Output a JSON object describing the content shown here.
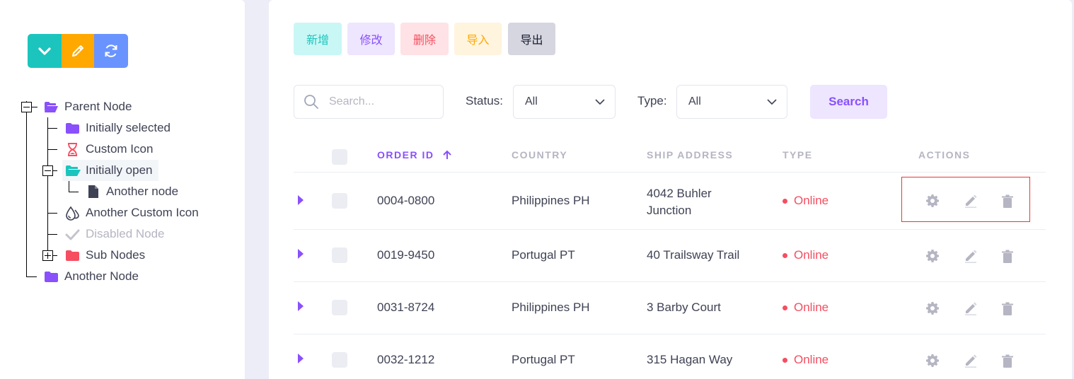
{
  "tree": {
    "toolbar": {
      "expand_icon": "chevron-down-icon",
      "edit_icon": "pencil-icon",
      "refresh_icon": "refresh-icon",
      "colors": {
        "teal": "#1bc5bd",
        "orange": "#ffa800",
        "blue": "#6993ff"
      }
    },
    "nodes": [
      {
        "label": "Parent Node",
        "icon": "folder-open-icon",
        "color": "#8950fc"
      },
      {
        "label": "Initially selected",
        "icon": "folder-icon",
        "color": "#8950fc"
      },
      {
        "label": "Custom Icon",
        "icon": "hourglass-icon",
        "color": "#f64e60"
      },
      {
        "label": "Initially open",
        "icon": "folder-open-icon",
        "color": "#1bc5bd"
      },
      {
        "label": "Another node",
        "icon": "file-icon",
        "color": "#3f4254"
      },
      {
        "label": "Another Custom Icon",
        "icon": "drop-icon",
        "color": "#3f4254"
      },
      {
        "label": "Disabled Node",
        "icon": "check-icon",
        "color": "#b5b5c3"
      },
      {
        "label": "Sub Nodes",
        "icon": "folder-icon",
        "color": "#f64e60"
      },
      {
        "label": "Another Node",
        "icon": "folder-icon",
        "color": "#8950fc"
      }
    ]
  },
  "actions": {
    "add": "新增",
    "edit": "修改",
    "delete": "删除",
    "import": "导入",
    "export": "导出"
  },
  "filters": {
    "search_placeholder": "Search...",
    "status_label": "Status:",
    "status_value": "All",
    "type_label": "Type:",
    "type_value": "All",
    "search_button": "Search"
  },
  "table": {
    "headers": {
      "order_id": "ORDER ID",
      "country": "COUNTRY",
      "ship_address": "SHIP ADDRESS",
      "type": "TYPE",
      "actions": "ACTIONS"
    },
    "sort": {
      "column": "order_id",
      "direction": "ascending"
    },
    "rows": [
      {
        "order_id": "0004-0800",
        "country": "Philippines PH",
        "address_line1": "4042 Buhler",
        "address_line2": "Junction",
        "type": "Online"
      },
      {
        "order_id": "0019-9450",
        "country": "Portugal PT",
        "address_line1": "40 Trailsway Trail",
        "address_line2": "",
        "type": "Online"
      },
      {
        "order_id": "0031-8724",
        "country": "Philippines PH",
        "address_line1": "3 Barby Court",
        "address_line2": "",
        "type": "Online"
      },
      {
        "order_id": "0032-1212",
        "country": "Portugal PT",
        "address_line1": "315 Hagan Way",
        "address_line2": "",
        "type": "Online"
      }
    ],
    "row_action_icons": [
      "gear-icon",
      "pencil-icon",
      "trash-icon"
    ],
    "status_color": "#f64e60",
    "accent_color": "#8950fc"
  }
}
